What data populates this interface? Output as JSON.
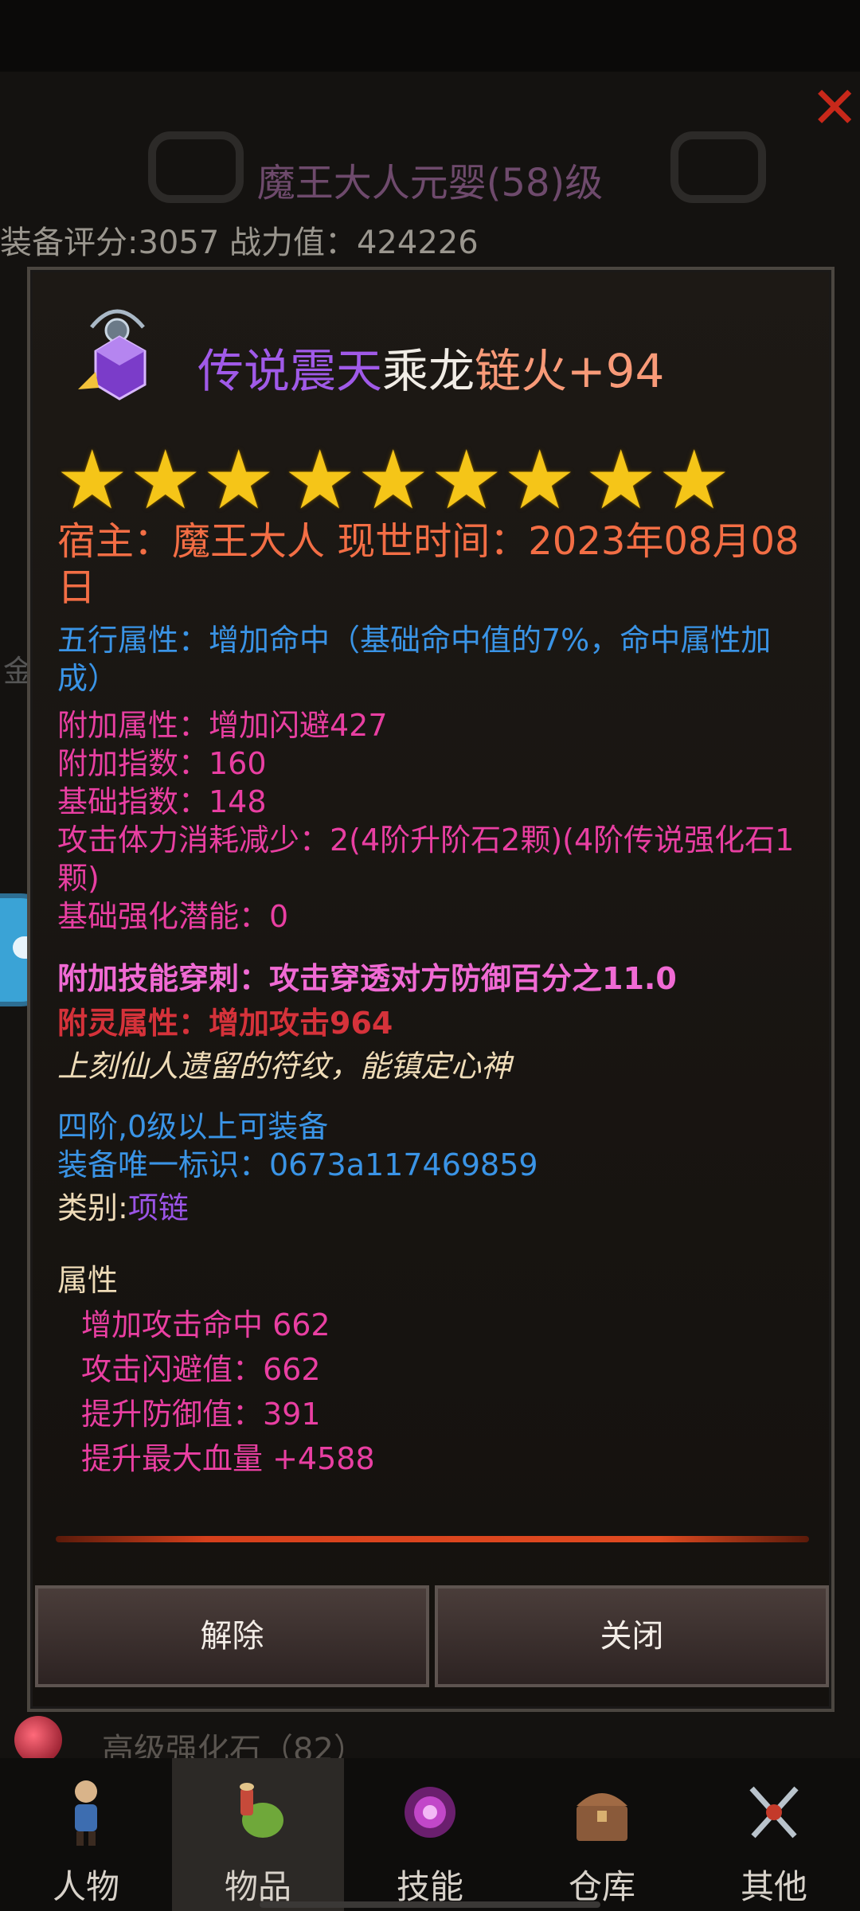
{
  "background": {
    "window_title": "魔王大人元婴(58)级",
    "score_line": "装备评分:3057  战力值：424226",
    "side_label": "金",
    "bottom_item": "高级强化石（82）"
  },
  "item": {
    "name_parts": [
      {
        "text": "传说震天",
        "color": "#a05ae8"
      },
      {
        "text": "乘龙",
        "color": "#f1ede6"
      },
      {
        "text": "链火+94",
        "color": "#f89a78"
      }
    ],
    "star_count": 9,
    "owner_line": "宿主：魔王大人  现世时间：2023年08月08日",
    "five_elements": "五行属性：增加命中（基础命中值的7%，命中属性加成）",
    "extra_attr": "附加属性：增加闪避427",
    "extra_index": "附加指数：160",
    "base_index": "基础指数：148",
    "stamina_reduce": "攻击体力消耗减少：2(4阶升阶石2颗)(4阶传说强化石1颗)",
    "base_potential": "基础强化潜能：0",
    "skill_pierce": "附加技能穿刺：攻击穿透对方防御百分之11.0",
    "spirit_attr": "附灵属性：增加攻击964",
    "flavor_text": "上刻仙人遗留的符纹，能镇定心神",
    "requirement": "四阶,0级以上可装备",
    "unique_id": "装备唯一标识：0673a117469859",
    "category_label": "类别:",
    "category_value": "项链",
    "attributes_header": "属性",
    "attributes": [
      "增加攻击命中  662",
      "攻击闪避值：662",
      "提升防御值：391",
      "提升最大血量  +4588"
    ]
  },
  "buttons": {
    "remove": "解除",
    "close": "关闭"
  },
  "nav": [
    {
      "label": "人物",
      "icon": "character-icon"
    },
    {
      "label": "物品",
      "icon": "items-bag-icon"
    },
    {
      "label": "技能",
      "icon": "skill-orb-icon"
    },
    {
      "label": "仓库",
      "icon": "chest-icon"
    },
    {
      "label": "其他",
      "icon": "swords-icon"
    }
  ],
  "colors": {
    "legend_purple": "#a05ae8",
    "owner_orange": "#f36e45",
    "info_blue": "#3a94e6",
    "attr_pink": "#e93fa2",
    "spirit_red": "#d5323a",
    "star_gold": "#f5c518"
  }
}
